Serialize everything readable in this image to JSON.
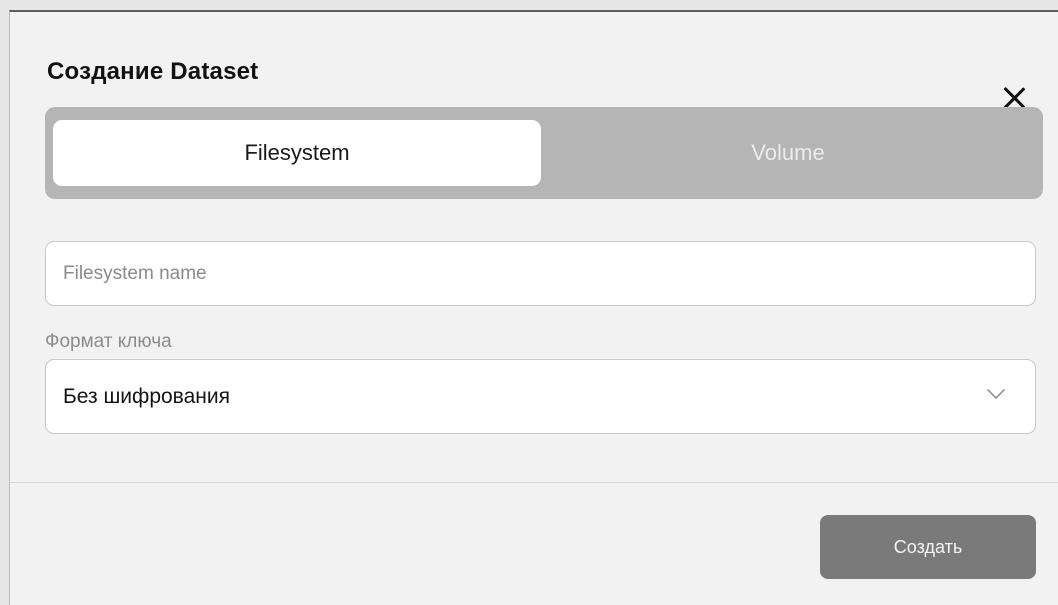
{
  "dialog": {
    "title": "Создание Dataset",
    "close_icon": "close-icon"
  },
  "tabs": [
    {
      "label": "Filesystem",
      "active": true
    },
    {
      "label": "Volume",
      "active": false
    }
  ],
  "name_field": {
    "placeholder": "Filesystem name",
    "value": ""
  },
  "key_format": {
    "label": "Формат ключа",
    "selected": "Без шифрования",
    "icon": "chevron-down-icon"
  },
  "footer": {
    "create_label": "Создать"
  },
  "colors": {
    "segmented_bg": "#b5b5b5",
    "active_tab_bg": "#ffffff",
    "create_button_bg": "#7a7a7a"
  }
}
